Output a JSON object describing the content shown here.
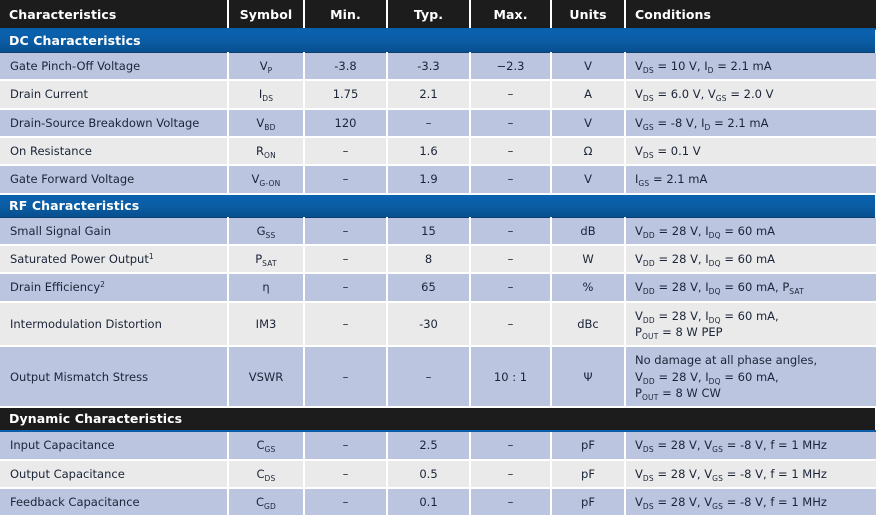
{
  "table": {
    "columns": [
      {
        "key": "characteristics",
        "label": "Characteristics",
        "align": "left"
      },
      {
        "key": "symbol",
        "label": "Symbol",
        "align": "center"
      },
      {
        "key": "min",
        "label": "Min.",
        "align": "center"
      },
      {
        "key": "typ",
        "label": "Typ.",
        "align": "center"
      },
      {
        "key": "max",
        "label": "Max.",
        "align": "center"
      },
      {
        "key": "units",
        "label": "Units",
        "align": "center"
      },
      {
        "key": "conditions",
        "label": "Conditions",
        "align": "left"
      }
    ],
    "sections": [
      {
        "title": "DC Characteristics",
        "style": "blue",
        "rows": [
          {
            "characteristic": "Gate Pinch-Off Voltage",
            "symbol": "V_P",
            "min": "-3.8",
            "typ": "-3.3",
            "max": "−2.3",
            "units": "V",
            "conditions": [
              "V_DS = 10 V, I_D = 2.1 mA"
            ]
          },
          {
            "characteristic": "Drain Current",
            "symbol": "I_DS",
            "min": "1.75",
            "typ": "2.1",
            "max": "–",
            "units": "A",
            "conditions": [
              "V_DS = 6.0 V, V_GS = 2.0 V"
            ]
          },
          {
            "characteristic": "Drain-Source Breakdown Voltage",
            "symbol": "V_BD",
            "min": "120",
            "typ": "–",
            "max": "–",
            "units": "V",
            "conditions": [
              "V_GS = -8 V, I_D = 2.1 mA"
            ]
          },
          {
            "characteristic": "On Resistance",
            "symbol": "R_ON",
            "min": "–",
            "typ": "1.6",
            "max": "–",
            "units": "Ω",
            "conditions": [
              "V_DS = 0.1 V"
            ]
          },
          {
            "characteristic": "Gate Forward Voltage",
            "symbol": "V_G-ON",
            "min": "–",
            "typ": "1.9",
            "max": "–",
            "units": "V",
            "conditions": [
              "I_GS = 2.1 mA"
            ]
          }
        ]
      },
      {
        "title": "RF Characteristics",
        "style": "blue",
        "rows": [
          {
            "characteristic": "Small Signal Gain",
            "symbol": "G_SS",
            "min": "–",
            "typ": "15",
            "max": "–",
            "units": "dB",
            "conditions": [
              "V_DD = 28 V, I_DQ = 60 mA"
            ]
          },
          {
            "characteristic": "Saturated Power Output¹",
            "symbol": "P_SAT",
            "min": "–",
            "typ": "8",
            "max": "–",
            "units": "W",
            "conditions": [
              "V_DD = 28 V, I_DQ = 60 mA"
            ]
          },
          {
            "characteristic": "Drain Efficiency²",
            "symbol": "η",
            "min": "–",
            "typ": "65",
            "max": "–",
            "units": "%",
            "conditions": [
              "V_DD = 28 V, I_DQ = 60 mA, P_SAT"
            ]
          },
          {
            "characteristic": "Intermodulation Distortion",
            "symbol": "IM3",
            "min": "–",
            "typ": "-30",
            "max": "–",
            "units": "dBc",
            "conditions": [
              "V_DD = 28 V, I_DQ = 60 mA,",
              "P_OUT = 8 W PEP"
            ]
          },
          {
            "characteristic": "Output Mismatch Stress",
            "symbol": "VSWR",
            "min": "–",
            "typ": "–",
            "max": "10 : 1",
            "units": "Ψ",
            "conditions": [
              "No damage at all phase angles,",
              "V_DD = 28 V, I_DQ = 60 mA,",
              "P_OUT = 8 W CW"
            ]
          }
        ]
      },
      {
        "title": "Dynamic Characteristics",
        "style": "dark",
        "rows": [
          {
            "characteristic": "Input Capacitance",
            "symbol": "C_GS",
            "min": "–",
            "typ": "2.5",
            "max": "–",
            "units": "pF",
            "conditions": [
              "V_DS = 28 V, V_GS = -8 V, f = 1 MHz"
            ]
          },
          {
            "characteristic": "Output Capacitance",
            "symbol": "C_DS",
            "min": "–",
            "typ": "0.5",
            "max": "–",
            "units": "pF",
            "conditions": [
              "V_DS = 28 V, V_GS = -8 V, f = 1 MHz"
            ]
          },
          {
            "characteristic": "Feedback Capacitance",
            "symbol": "C_GD",
            "min": "–",
            "typ": "0.1",
            "max": "–",
            "units": "pF",
            "conditions": [
              "V_DS = 28 V, V_GS = -8 V, f = 1 MHz"
            ]
          }
        ]
      }
    ]
  },
  "colors": {
    "header_bg": "#1c1c1c",
    "section_blue": "#0a5fa8",
    "row_alt_blue": "#bcc5e0",
    "row_alt_gray": "#eaeaea",
    "text": "#1b2437"
  }
}
